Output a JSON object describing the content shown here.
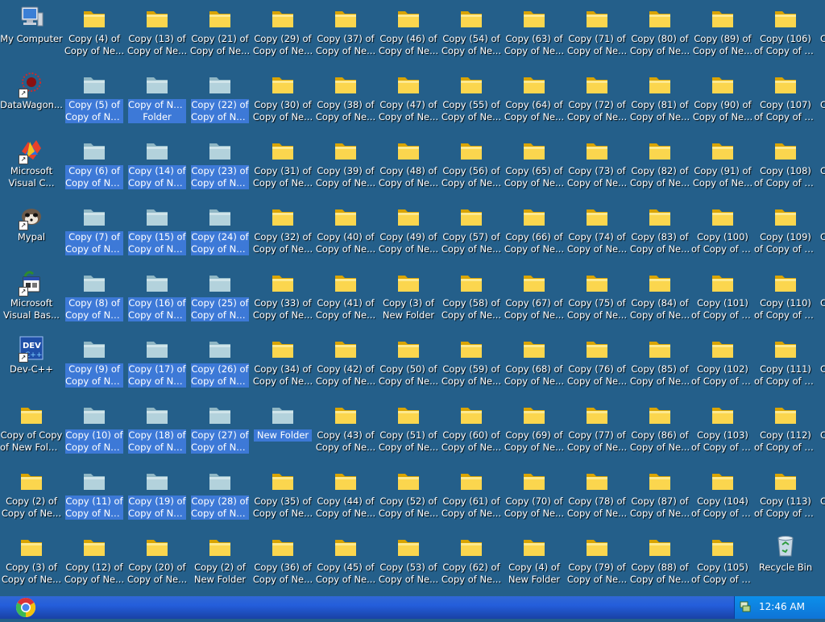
{
  "desktop": {
    "icons": [
      {
        "label": "My Computer",
        "type": "computer"
      },
      {
        "label": "Copy (4) of Copy of Ne...",
        "type": "folder"
      },
      {
        "label": "Copy (13) of Copy of Ne...",
        "type": "folder"
      },
      {
        "label": "Copy (21) of Copy of Ne...",
        "type": "folder"
      },
      {
        "label": "Copy (29) of Copy of Ne...",
        "type": "folder"
      },
      {
        "label": "Copy (37) of Copy of Ne...",
        "type": "folder"
      },
      {
        "label": "Copy (46) of Copy of Ne...",
        "type": "folder"
      },
      {
        "label": "Copy (54) of Copy of Ne...",
        "type": "folder"
      },
      {
        "label": "Copy (63) of Copy of Ne...",
        "type": "folder"
      },
      {
        "label": "Copy (71) of Copy of Ne...",
        "type": "folder"
      },
      {
        "label": "Copy (80) of Copy of Ne...",
        "type": "folder"
      },
      {
        "label": "Copy (89) of Copy of Ne...",
        "type": "folder"
      },
      {
        "label": "Copy (106) of Copy of Ne...",
        "type": "folder"
      },
      {
        "label": "DataWagon...",
        "type": "app-datawagon",
        "shortcut": true
      },
      {
        "label": "Copy (5) of Copy of Ne...",
        "type": "folder",
        "selected": true
      },
      {
        "label": "Copy of New Folder",
        "type": "folder",
        "selected": true
      },
      {
        "label": "Copy (22) of Copy of Ne...",
        "type": "folder",
        "selected": true
      },
      {
        "label": "Copy (30) of Copy of Ne...",
        "type": "folder"
      },
      {
        "label": "Copy (38) of Copy of Ne...",
        "type": "folder"
      },
      {
        "label": "Copy (47) of Copy of Ne...",
        "type": "folder"
      },
      {
        "label": "Copy (55) of Copy of Ne...",
        "type": "folder"
      },
      {
        "label": "Copy (64) of Copy of Ne...",
        "type": "folder"
      },
      {
        "label": "Copy (72) of Copy of Ne...",
        "type": "folder"
      },
      {
        "label": "Copy (81) of Copy of Ne...",
        "type": "folder"
      },
      {
        "label": "Copy (90) of Copy of Ne...",
        "type": "folder"
      },
      {
        "label": "Copy (107) of Copy of Ne...",
        "type": "folder"
      },
      {
        "label": "Microsoft Visual C...",
        "type": "app-vc",
        "shortcut": true
      },
      {
        "label": "Copy (6) of Copy of Ne...",
        "type": "folder",
        "selected": true
      },
      {
        "label": "Copy (14) of Copy of Ne...",
        "type": "folder",
        "selected": true
      },
      {
        "label": "Copy (23) of Copy of Ne...",
        "type": "folder",
        "selected": true
      },
      {
        "label": "Copy (31) of Copy of Ne...",
        "type": "folder"
      },
      {
        "label": "Copy (39) of Copy of Ne...",
        "type": "folder"
      },
      {
        "label": "Copy (48) of Copy of Ne...",
        "type": "folder"
      },
      {
        "label": "Copy (56) of Copy of Ne...",
        "type": "folder"
      },
      {
        "label": "Copy (65) of Copy of Ne...",
        "type": "folder"
      },
      {
        "label": "Copy (73) of Copy of Ne...",
        "type": "folder"
      },
      {
        "label": "Copy (82) of Copy of Ne...",
        "type": "folder"
      },
      {
        "label": "Copy (91) of Copy of Ne...",
        "type": "folder"
      },
      {
        "label": "Copy (108) of Copy of Ne...",
        "type": "folder"
      },
      {
        "label": "Mypal",
        "type": "app-mypal",
        "shortcut": true
      },
      {
        "label": "Copy (7) of Copy of Ne...",
        "type": "folder",
        "selected": true
      },
      {
        "label": "Copy (15) of Copy of Ne...",
        "type": "folder",
        "selected": true
      },
      {
        "label": "Copy (24) of Copy of Ne...",
        "type": "folder",
        "selected": true
      },
      {
        "label": "Copy (32) of Copy of Ne...",
        "type": "folder"
      },
      {
        "label": "Copy (40) of Copy of Ne...",
        "type": "folder"
      },
      {
        "label": "Copy (49) of Copy of Ne...",
        "type": "folder"
      },
      {
        "label": "Copy (57) of Copy of Ne...",
        "type": "folder"
      },
      {
        "label": "Copy (66) of Copy of Ne...",
        "type": "folder"
      },
      {
        "label": "Copy (74) of Copy of Ne...",
        "type": "folder"
      },
      {
        "label": "Copy (83) of Copy of Ne...",
        "type": "folder"
      },
      {
        "label": "Copy (100) of Copy of Ne...",
        "type": "folder"
      },
      {
        "label": "Copy (109) of Copy of Ne...",
        "type": "folder"
      },
      {
        "label": "Microsoft Visual Bas...",
        "type": "app-vb",
        "shortcut": true
      },
      {
        "label": "Copy (8) of Copy of Ne...",
        "type": "folder",
        "selected": true
      },
      {
        "label": "Copy (16) of Copy of Ne...",
        "type": "folder",
        "selected": true
      },
      {
        "label": "Copy (25) of Copy of Ne...",
        "type": "folder",
        "selected": true
      },
      {
        "label": "Copy (33) of Copy of Ne...",
        "type": "folder"
      },
      {
        "label": "Copy (41) of Copy of Ne...",
        "type": "folder"
      },
      {
        "label": "Copy (3) of New Folder",
        "type": "folder"
      },
      {
        "label": "Copy (58) of Copy of Ne...",
        "type": "folder"
      },
      {
        "label": "Copy (67) of Copy of Ne...",
        "type": "folder"
      },
      {
        "label": "Copy (75) of Copy of Ne...",
        "type": "folder"
      },
      {
        "label": "Copy (84) of Copy of Ne...",
        "type": "folder"
      },
      {
        "label": "Copy (101) of Copy of Ne...",
        "type": "folder"
      },
      {
        "label": "Copy (110) of Copy of Ne...",
        "type": "folder"
      },
      {
        "label": "Dev-C++",
        "type": "app-devcpp",
        "shortcut": true
      },
      {
        "label": "Copy (9) of Copy of Ne...",
        "type": "folder",
        "selected": true
      },
      {
        "label": "Copy (17) of Copy of Ne...",
        "type": "folder",
        "selected": true
      },
      {
        "label": "Copy (26) of Copy of Ne...",
        "type": "folder",
        "selected": true
      },
      {
        "label": "Copy (34) of Copy of Ne...",
        "type": "folder"
      },
      {
        "label": "Copy (42) of Copy of Ne...",
        "type": "folder"
      },
      {
        "label": "Copy (50) of Copy of Ne...",
        "type": "folder"
      },
      {
        "label": "Copy (59) of Copy of Ne...",
        "type": "folder"
      },
      {
        "label": "Copy (68) of Copy of Ne...",
        "type": "folder"
      },
      {
        "label": "Copy (76) of Copy of Ne...",
        "type": "folder"
      },
      {
        "label": "Copy (85) of Copy of Ne...",
        "type": "folder"
      },
      {
        "label": "Copy (102) of Copy of Ne...",
        "type": "folder"
      },
      {
        "label": "Copy (111) of Copy of Ne...",
        "type": "folder"
      },
      {
        "label": "Copy of Copy of New Folder",
        "type": "folder"
      },
      {
        "label": "Copy (10) of Copy of Ne...",
        "type": "folder",
        "selected": true
      },
      {
        "label": "Copy (18) of Copy of Ne...",
        "type": "folder",
        "selected": true
      },
      {
        "label": "Copy (27) of Copy of Ne...",
        "type": "folder",
        "selected": true
      },
      {
        "label": "New Folder",
        "type": "folder",
        "selected": true
      },
      {
        "label": "Copy (43) of Copy of Ne...",
        "type": "folder"
      },
      {
        "label": "Copy (51) of Copy of Ne...",
        "type": "folder"
      },
      {
        "label": "Copy (60) of Copy of Ne...",
        "type": "folder"
      },
      {
        "label": "Copy (69) of Copy of Ne...",
        "type": "folder"
      },
      {
        "label": "Copy (77) of Copy of Ne...",
        "type": "folder"
      },
      {
        "label": "Copy (86) of Copy of Ne...",
        "type": "folder"
      },
      {
        "label": "Copy (103) of Copy of Ne...",
        "type": "folder"
      },
      {
        "label": "Copy (112) of Copy of Ne...",
        "type": "folder"
      },
      {
        "label": "Copy (2) of Copy of Ne...",
        "type": "folder"
      },
      {
        "label": "Copy (11) of Copy of Ne...",
        "type": "folder",
        "selected": true
      },
      {
        "label": "Copy (19) of Copy of Ne...",
        "type": "folder",
        "selected": true
      },
      {
        "label": "Copy (28) of Copy of Ne...",
        "type": "folder",
        "selected": true
      },
      {
        "label": "Copy (35) of Copy of Ne...",
        "type": "folder"
      },
      {
        "label": "Copy (44) of Copy of Ne...",
        "type": "folder"
      },
      {
        "label": "Copy (52) of Copy of Ne...",
        "type": "folder"
      },
      {
        "label": "Copy (61) of Copy of Ne...",
        "type": "folder"
      },
      {
        "label": "Copy (70) of Copy of Ne...",
        "type": "folder"
      },
      {
        "label": "Copy (78) of Copy of Ne...",
        "type": "folder"
      },
      {
        "label": "Copy (87) of Copy of Ne...",
        "type": "folder"
      },
      {
        "label": "Copy (104) of Copy of Ne...",
        "type": "folder"
      },
      {
        "label": "Copy (113) of Copy of Ne...",
        "type": "folder"
      },
      {
        "label": "Copy (3) of Copy of Ne...",
        "type": "folder"
      },
      {
        "label": "Copy (12) of Copy of Ne...",
        "type": "folder"
      },
      {
        "label": "Copy (20) of Copy of Ne...",
        "type": "folder"
      },
      {
        "label": "Copy (2) of New Folder",
        "type": "folder"
      },
      {
        "label": "Copy (36) of Copy of Ne...",
        "type": "folder"
      },
      {
        "label": "Copy (45) of Copy of Ne...",
        "type": "folder"
      },
      {
        "label": "Copy (53) of Copy of Ne...",
        "type": "folder"
      },
      {
        "label": "Copy (62) of Copy of Ne...",
        "type": "folder"
      },
      {
        "label": "Copy (4) of New Folder",
        "type": "folder"
      },
      {
        "label": "Copy (79) of Copy of Ne...",
        "type": "folder"
      },
      {
        "label": "Copy (88) of Copy of Ne...",
        "type": "folder"
      },
      {
        "label": "Copy (105) of Copy of Ne...",
        "type": "folder"
      },
      {
        "label": "Recycle Bin",
        "type": "recycle-bin"
      }
    ],
    "edge_labels": [
      "C",
      "C",
      "C",
      "C",
      "C",
      "C",
      "C",
      "C"
    ]
  },
  "taskbar": {
    "start_button_icon": "browser-orb-icon",
    "tray_icon": "network-tray-icon",
    "clock": "12:46 AM"
  },
  "colors": {
    "desktop_bg": "#245f8a",
    "selection": "#3d79d7",
    "taskbar": "#245edb",
    "tray": "#0f8ae6"
  }
}
